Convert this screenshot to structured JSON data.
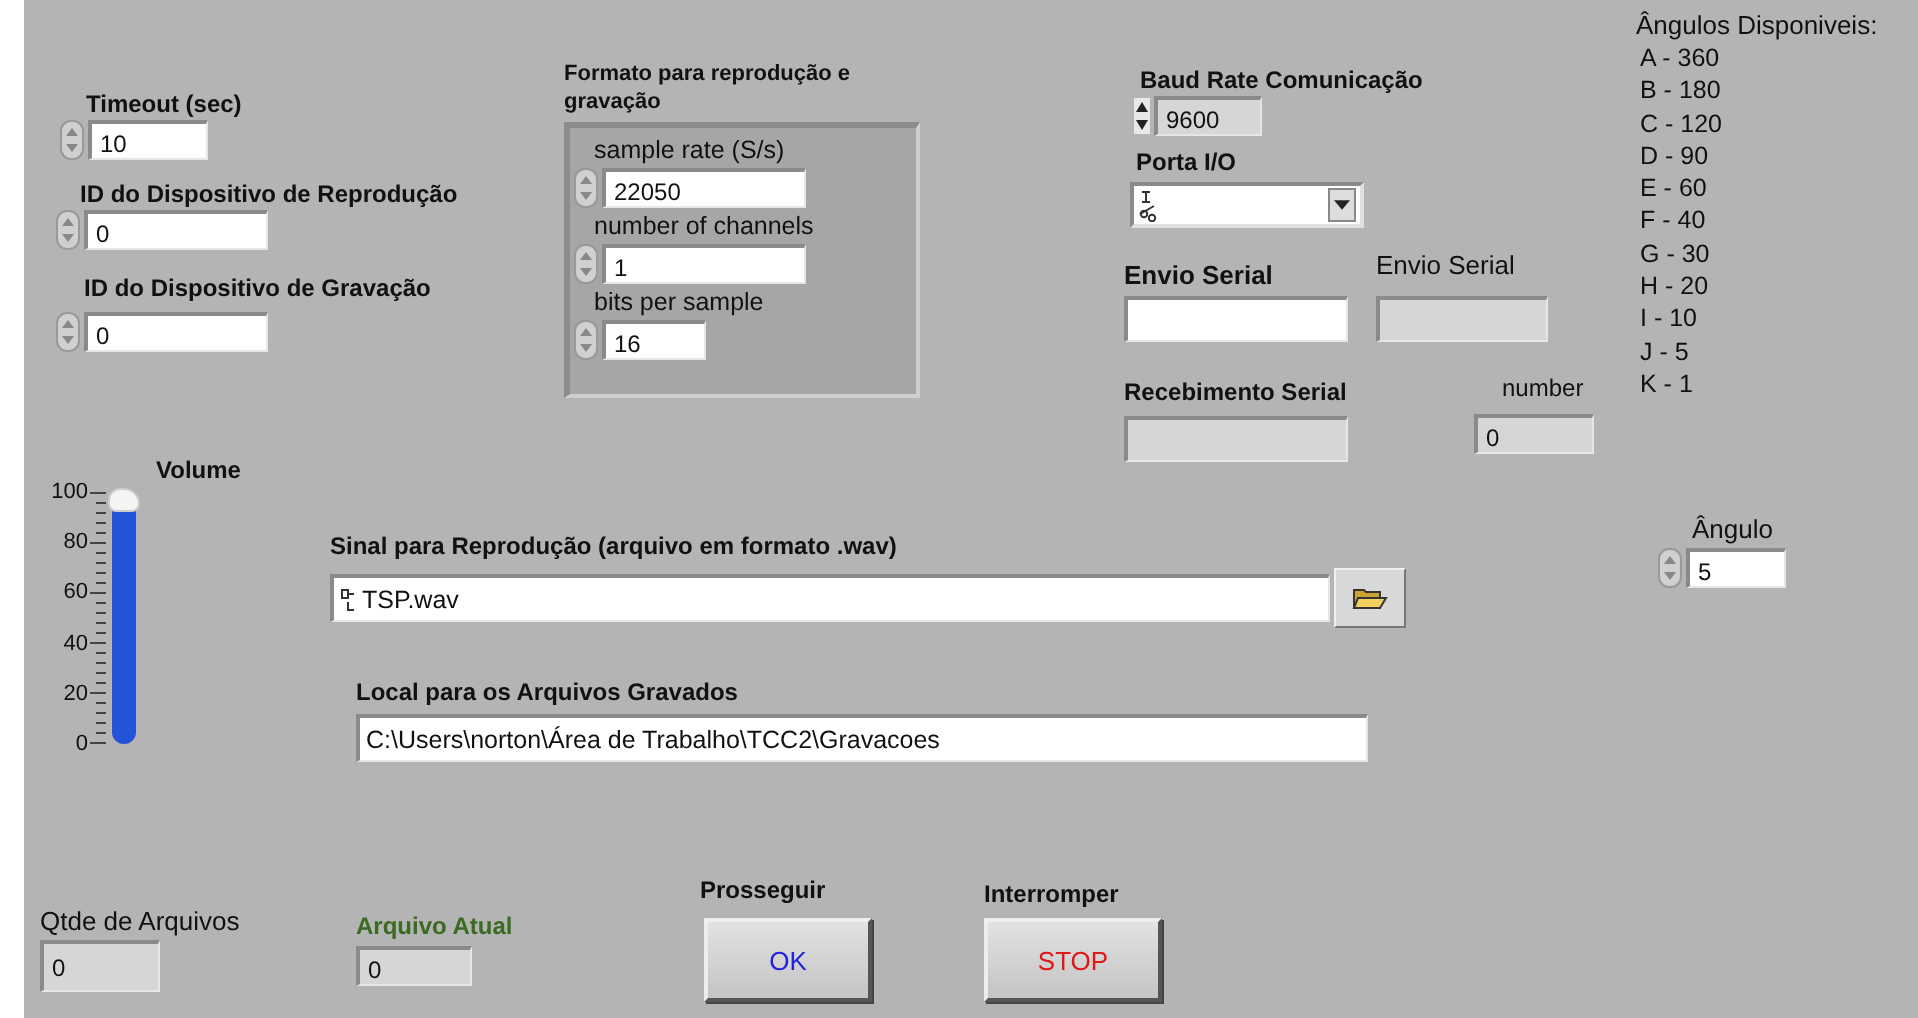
{
  "timeout": {
    "label": "Timeout (sec)",
    "value": "10",
    "kind": "control"
  },
  "playback_device": {
    "label": "ID do Dispositivo de Reprodução",
    "value": "0",
    "kind": "control"
  },
  "record_device": {
    "label": "ID do Dispositivo de Gravação",
    "value": "0",
    "kind": "control"
  },
  "format": {
    "title": "Formato para reprodução e gravação",
    "fields": [
      {
        "label": "sample rate (S/s)",
        "value": "22050",
        "kind": "control"
      },
      {
        "label": "number of channels",
        "value": "1",
        "kind": "control"
      },
      {
        "label": "bits per sample",
        "value": "16",
        "kind": "control"
      }
    ]
  },
  "baud_rate": {
    "label": "Baud Rate Comunicação",
    "value": "9600",
    "kind": "stepper"
  },
  "port": {
    "label": "Porta I/O"
  },
  "serial_send": {
    "label": "Envio Serial",
    "kind": "control"
  },
  "serial_send_indicator": {
    "label": "Envio Serial",
    "kind": "indicator"
  },
  "serial_receive": {
    "label": "Recebimento Serial",
    "kind": "indicator"
  },
  "number": {
    "label": "number",
    "value": "0",
    "kind": "indicator"
  },
  "angles": {
    "title": "Ângulos Disponiveis:",
    "items": [
      "A - 360",
      "B - 180",
      "C - 120",
      "D - 90",
      "E - 60",
      "F - 40",
      "G - 30",
      "H - 20",
      "I - 10",
      "J - 5",
      "K - 1"
    ]
  },
  "volume": {
    "label": "Volume",
    "level": 1,
    "ticks": [
      "100",
      "80",
      "60",
      "40",
      "20",
      "0"
    ]
  },
  "playback_file": {
    "label": "Sinal para Reprodução (arquivo em formato .wav)",
    "value": "TSP.wav"
  },
  "record_folder": {
    "label": "Local para os Arquivos Gravados",
    "value": "C:\\Users\\norton\\Área de Trabalho\\TCC2\\Gravacoes"
  },
  "angle": {
    "label": "Ângulo",
    "value": "5",
    "kind": "control"
  },
  "file_count": {
    "label": "Qtde de Arquivos",
    "value": "0",
    "kind": "indicator"
  },
  "current_file": {
    "label": "Arquivo Atual",
    "value": "0",
    "kind": "indicator"
  },
  "ok_button": {
    "label": "Prosseguir",
    "text": "OK"
  },
  "stop_button": {
    "label": "Interromper",
    "text": "STOP"
  }
}
